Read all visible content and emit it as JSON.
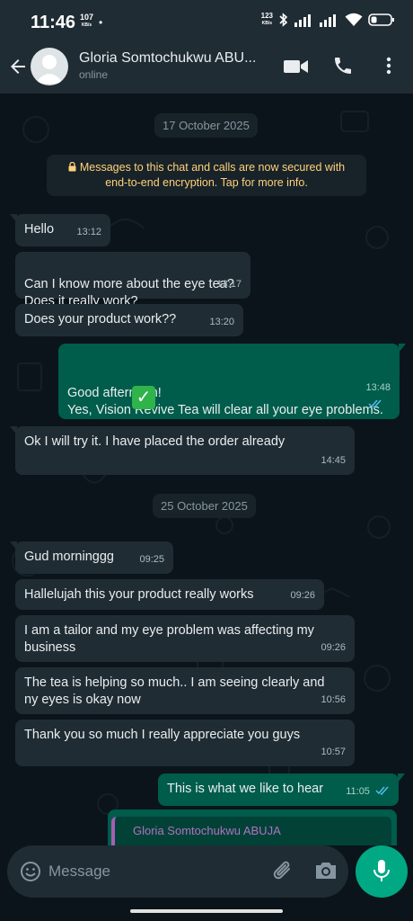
{
  "status_bar": {
    "time": "11:46",
    "speed_value": "107",
    "speed_unit": "KB/s",
    "speed2_value": "123",
    "speed2_unit": "KB/s"
  },
  "header": {
    "contact_name": "Gloria Somtochukwu ABU...",
    "status": "online",
    "icons": [
      "back-arrow-icon",
      "avatar",
      "video-call-icon",
      "phone-icon",
      "more-vert-icon"
    ]
  },
  "chat": {
    "date1": "17 October 2025",
    "encryption_notice": "Messages to this chat and calls are now secured with end-to-end encryption. Tap for more info.",
    "messages": [
      {
        "text": "Hello",
        "time": "13:12",
        "dir": "in"
      },
      {
        "text": "Can I know more about the eye tea?\nDoes it really work?",
        "time": "13:17",
        "dir": "in"
      },
      {
        "text": "Does your product work??",
        "time": "13:20",
        "dir": "in"
      },
      {
        "text": "Good afternoon!\nYes, Vision Revive Tea will clear all your eye problems.",
        "time": "13:48",
        "dir": "out"
      },
      {
        "text": "Ok I will try it. I have placed the order already",
        "time": "14:45",
        "dir": "in"
      },
      {
        "text": "Gud morninggg",
        "time": "09:25",
        "dir": "in"
      },
      {
        "text": "Hallelujah this your product really works",
        "time": "09:26",
        "dir": "in"
      },
      {
        "text": "I am a tailor and my eye problem was affecting my business",
        "time": "09:26",
        "dir": "in"
      },
      {
        "text": "The tea is helping so much.. I am seeing clearly and ny eyes is okay now",
        "time": "10:56",
        "dir": "in"
      },
      {
        "text": "Thank you so much I really appreciate you guys",
        "time": "10:57",
        "dir": "in"
      },
      {
        "text": "This is what we like to hear",
        "time": "11:05",
        "dir": "out"
      }
    ],
    "date2": "25 October 2025",
    "reply_preview_name": "Gloria Somtochukwu ABUJA"
  },
  "input": {
    "placeholder": "Message"
  },
  "colors": {
    "background": "#0b141a",
    "bar": "#1f2c34",
    "incoming": "#202c33",
    "outgoing": "#005c4b",
    "accent": "#00a884",
    "encryption_text": "#ffd279",
    "read_ticks": "#53bdeb"
  }
}
